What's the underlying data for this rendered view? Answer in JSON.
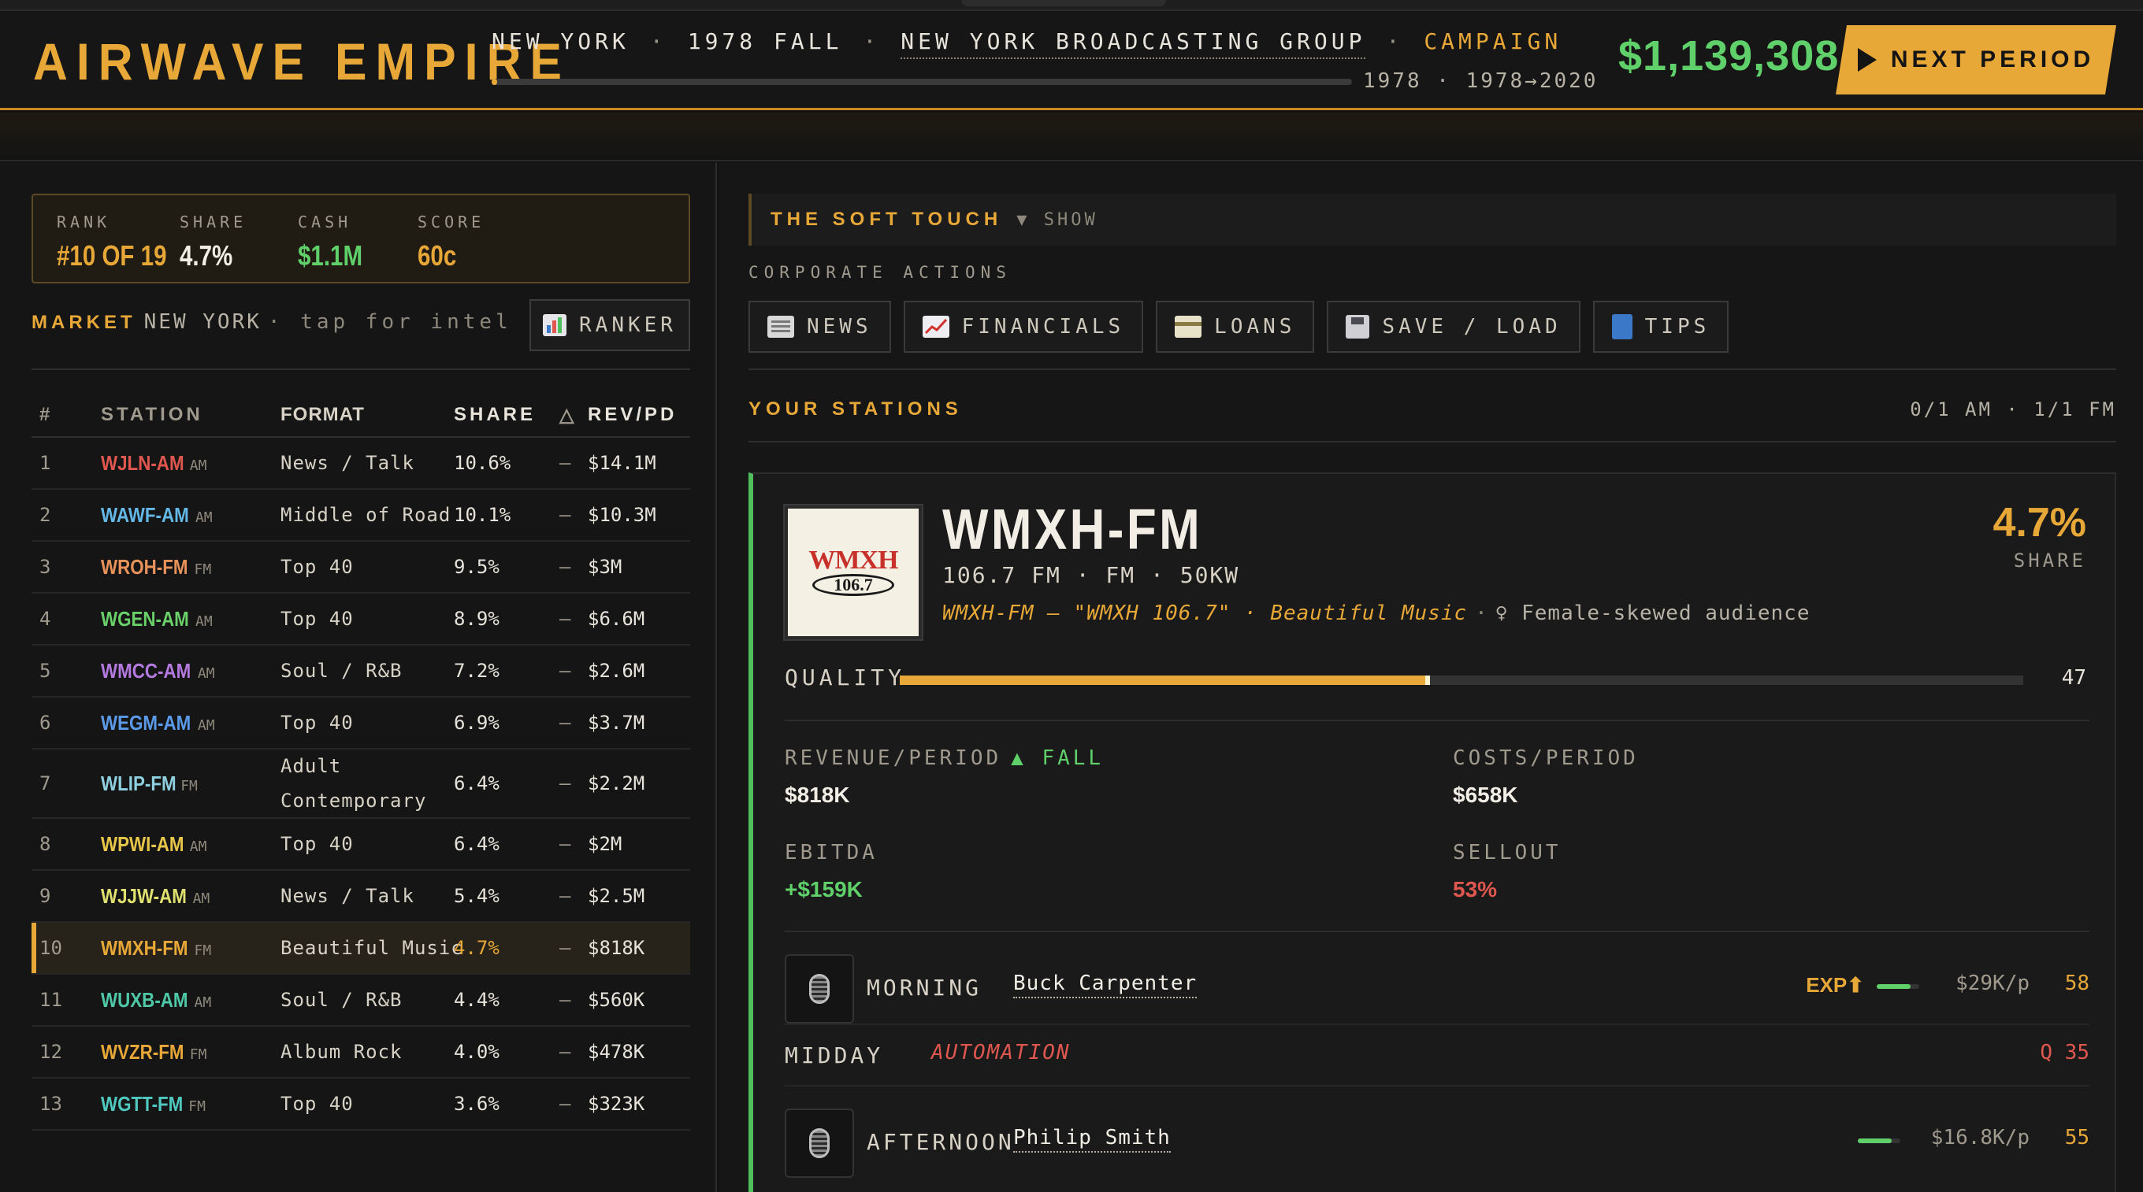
{
  "header": {
    "brand": "AIRWAVE EMPIRE",
    "market": "NEW YORK",
    "period": "1978 FALL",
    "company": "NEW YORK BROADCASTING GROUP",
    "mode": "CAMPAIGN",
    "sep": "·",
    "timeline_label": "1978 · 1978→2020",
    "timeline_progress": 0.006,
    "cash": "$1,139,308",
    "next_label": "NEXT PERIOD"
  },
  "stats": {
    "rank_label": "RANK",
    "rank": "#10 OF 19",
    "share_label": "SHARE",
    "share": "4.7%",
    "cash_label": "CASH",
    "cash": "$1.1M",
    "score_label": "SCORE",
    "score": "60c"
  },
  "market": {
    "key": "MARKET",
    "name": "NEW YORK",
    "hint": "· tap for intel",
    "ranker_label": "RANKER"
  },
  "table": {
    "headers": [
      "#",
      "STATION",
      "FORMAT",
      "SHARE",
      "△",
      "REV/PD"
    ],
    "rows": [
      {
        "num": "1",
        "call": "WJLN-AM",
        "band": "AM",
        "format": "News / Talk",
        "share": "10.6%",
        "trend": "—",
        "rev": "$14.1M",
        "color": "#e0574f"
      },
      {
        "num": "2",
        "call": "WAWF-AM",
        "band": "AM",
        "format": "Middle of Road",
        "share": "10.1%",
        "trend": "—",
        "rev": "$10.3M",
        "color": "#63b8e8"
      },
      {
        "num": "3",
        "call": "WROH-FM",
        "band": "FM",
        "format": "Top 40",
        "share": "9.5%",
        "trend": "—",
        "rev": "$3M",
        "color": "#e8925a"
      },
      {
        "num": "4",
        "call": "WGEN-AM",
        "band": "AM",
        "format": "Top 40",
        "share": "8.9%",
        "trend": "—",
        "rev": "$6.6M",
        "color": "#6ad06a"
      },
      {
        "num": "5",
        "call": "WMCC-AM",
        "band": "AM",
        "format": "Soul / R&B",
        "share": "7.2%",
        "trend": "—",
        "rev": "$2.6M",
        "color": "#b57ae0"
      },
      {
        "num": "6",
        "call": "WEGM-AM",
        "band": "AM",
        "format": "Top 40",
        "share": "6.9%",
        "trend": "—",
        "rev": "$3.7M",
        "color": "#5a9ae8"
      },
      {
        "num": "7",
        "call": "WLIP-FM",
        "band": "FM",
        "format": "Adult Contemporary",
        "share": "6.4%",
        "trend": "—",
        "rev": "$2.2M",
        "color": "#8fd0e0"
      },
      {
        "num": "8",
        "call": "WPWI-AM",
        "band": "AM",
        "format": "Top 40",
        "share": "6.4%",
        "trend": "—",
        "rev": "$2M",
        "color": "#e8c64a"
      },
      {
        "num": "9",
        "call": "WJJW-AM",
        "band": "AM",
        "format": "News / Talk",
        "share": "5.4%",
        "trend": "—",
        "rev": "$2.5M",
        "color": "#e0e070"
      },
      {
        "num": "10",
        "call": "WMXH-FM",
        "band": "FM",
        "format": "Beautiful Music",
        "share": "4.7%",
        "trend": "—",
        "rev": "$818K",
        "color": "#e8a838",
        "highlight": true
      },
      {
        "num": "11",
        "call": "WUXB-AM",
        "band": "AM",
        "format": "Soul / R&B",
        "share": "4.4%",
        "trend": "—",
        "rev": "$560K",
        "color": "#4fc8a8"
      },
      {
        "num": "12",
        "call": "WVZR-FM",
        "band": "FM",
        "format": "Album Rock",
        "share": "4.0%",
        "trend": "—",
        "rev": "$478K",
        "color": "#e8a838"
      },
      {
        "num": "13",
        "call": "WGTT-FM",
        "band": "FM",
        "format": "Top 40",
        "share": "3.6%",
        "trend": "—",
        "rev": "$323K",
        "color": "#4fc8c0"
      }
    ]
  },
  "show": {
    "title": "THE SOFT TOUCH",
    "toggle": "▼ SHOW"
  },
  "corporate": {
    "label": "CORPORATE ACTIONS",
    "actions": [
      {
        "id": "news",
        "label": "NEWS"
      },
      {
        "id": "financials",
        "label": "FINANCIALS"
      },
      {
        "id": "loans",
        "label": "LOANS"
      },
      {
        "id": "save",
        "label": "SAVE / LOAD"
      },
      {
        "id": "tips",
        "label": "TIPS"
      }
    ]
  },
  "your_stations": {
    "label": "YOUR STATIONS",
    "count": "0/1 AM · 1/1 FM"
  },
  "station": {
    "logo_word": "WMXH",
    "logo_num": "106.7",
    "call": "WMXH-FM",
    "freq": "106.7 FM · FM · 50KW",
    "tagline": "WMXH-FM — \"WMXH 106.7\" · Beautiful Music",
    "tagline_sep": "·",
    "audience": "♀ Female-skewed audience",
    "share": "4.7%",
    "share_label": "SHARE",
    "quality_label": "QUALITY",
    "quality": 47,
    "quality_max": 100,
    "revenue_label": "REVENUE/PERIOD",
    "revenue_trend": "▲ FALL",
    "revenue": "$818K",
    "costs_label": "COSTS/PERIOD",
    "costs": "$658K",
    "ebitda_label": "EBITDA",
    "ebitda": "+$159K",
    "sellout_label": "SELLOUT",
    "sellout": "53%"
  },
  "dayparts": [
    {
      "name": "MORNING",
      "host": "Buck Carpenter",
      "exp": "EXP⬆",
      "cost": "$29K/p",
      "score": "58",
      "meter": 0.8
    },
    {
      "name": "MIDDAY",
      "host": "AUTOMATION",
      "score": "Q 35"
    },
    {
      "name": "AFTERNOON",
      "host": "Philip Smith",
      "cost": "$16.8K/p",
      "score": "55",
      "meter": 0.8
    }
  ],
  "colors": {
    "accent": "#e8a838",
    "positive": "#5fd06a",
    "negative": "#e0574f",
    "station_border": "#4fbf5e"
  }
}
